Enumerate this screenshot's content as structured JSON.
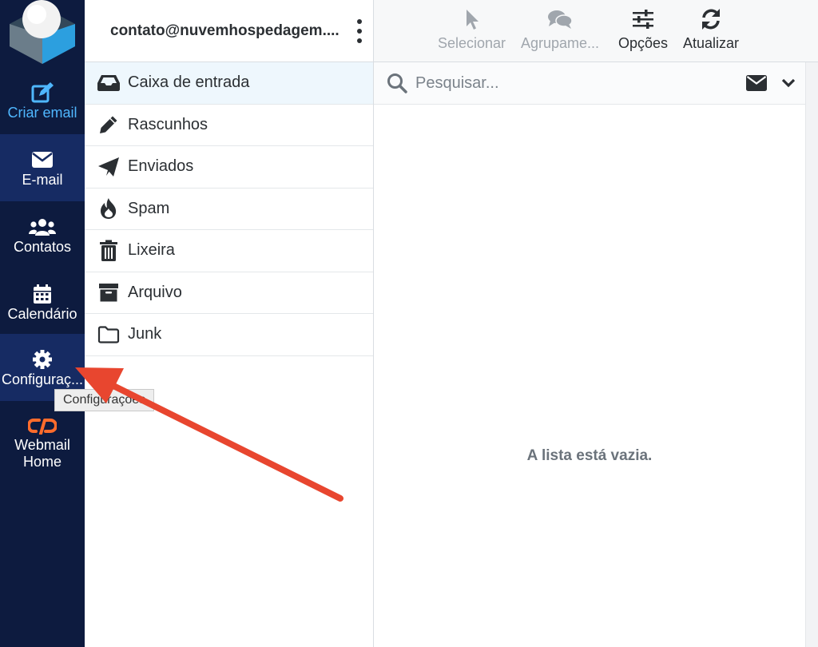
{
  "nav": {
    "compose": "Criar email",
    "email": "E-mail",
    "contacts": "Contatos",
    "calendar": "Calendário",
    "settings": "Configuraç...",
    "webmail_home": "Webmail\nHome"
  },
  "folders": {
    "account": "contato@nuvemhospedagem....",
    "items": [
      {
        "label": "Caixa de entrada",
        "icon": "inbox-icon"
      },
      {
        "label": "Rascunhos",
        "icon": "pencil-icon"
      },
      {
        "label": "Enviados",
        "icon": "paper-plane-icon"
      },
      {
        "label": "Spam",
        "icon": "fire-icon"
      },
      {
        "label": "Lixeira",
        "icon": "trash-icon"
      },
      {
        "label": "Arquivo",
        "icon": "archive-box-icon"
      },
      {
        "label": "Junk",
        "icon": "folder-icon"
      }
    ]
  },
  "toolbar": {
    "select": "Selecionar",
    "threads": "Agrupame...",
    "options": "Opções",
    "refresh": "Atualizar"
  },
  "search": {
    "placeholder": "Pesquisar..."
  },
  "list": {
    "empty": "A lista está vazia."
  },
  "tooltip": {
    "text": "Configurações"
  },
  "colors": {
    "nav_bg": "#0d1b3f",
    "nav_active": "#162b63",
    "compose_accent": "#4fb7ff",
    "cpanel_orange": "#ff6c2c",
    "arrow_red": "#e8462f"
  }
}
